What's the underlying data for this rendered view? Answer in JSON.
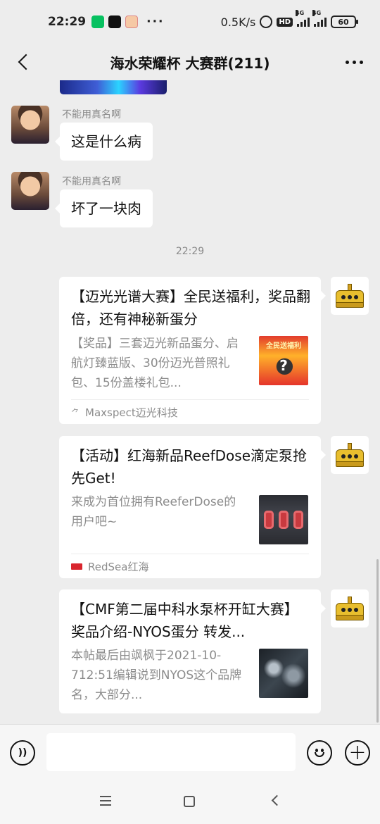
{
  "status_bar": {
    "time": "22:29",
    "apps": [
      "wechat-icon",
      "tiktok-icon",
      "pig-icon"
    ],
    "more": "···",
    "net_speed": "0.5K/s",
    "hd": "HD",
    "signal_1": "4G",
    "signal_2": "4G",
    "battery": "60"
  },
  "header": {
    "title": "海水荣耀杯 大赛群(211)"
  },
  "messages": [
    {
      "sender": "不能用真名啊",
      "text": "这是什么病"
    },
    {
      "sender": "不能用真名啊",
      "text": "坏了一块肉"
    }
  ],
  "timestamp": "22:29",
  "cards": [
    {
      "title": "【迈光光谱大赛】全民送福利，奖品翻倍，还有神秘新蛋分",
      "description": "【奖品】三套迈光新品蛋分、启航灯臻蓝版、30份迈光普照礼包、15份盖楼礼包...",
      "thumb_text": "全民送福利",
      "thumb_symbol": "?",
      "source": "Maxspect迈光科技",
      "source_icon": "⺈"
    },
    {
      "title": "【活动】红海新品ReefDose滴定泵抢先Get!",
      "description": "来成为首位拥有ReeferDose的用户吧~",
      "source": "RedSea红海"
    },
    {
      "title": "【CMF第二届中科水泵杯开缸大赛】奖品介绍-NYOS蛋分 转发...",
      "description": "本帖最后由飒枫于2021-10-712:51编辑说到NYOS这个品牌名，大部分...",
      "source": ""
    }
  ],
  "input_bar": {
    "voice_icon": "))",
    "placeholder": "",
    "add_icon": "+"
  },
  "colors": {
    "background": "#ededed",
    "bubble": "#ffffff",
    "meta_text": "#8a8a8a",
    "brand_red": "#d9262e"
  }
}
